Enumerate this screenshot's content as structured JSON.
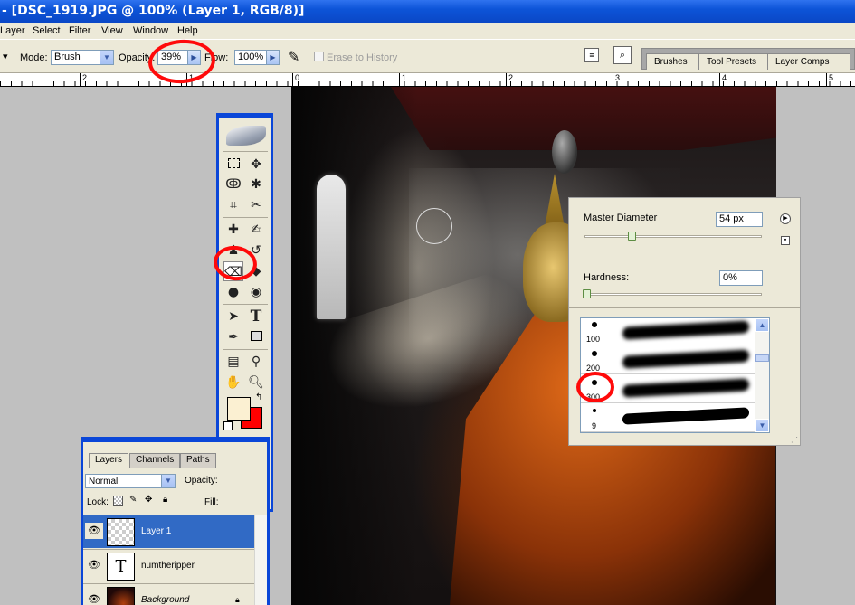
{
  "window": {
    "title": "- [DSC_1919.JPG @ 100% (Layer 1, RGB/8)]"
  },
  "menu": [
    "Layer",
    "Select",
    "Filter",
    "View",
    "Window",
    "Help"
  ],
  "options": {
    "tool_preset_arrow": "▾",
    "mode_label": "Mode:",
    "mode_value": "Brush",
    "opacity_label": "Opacity:",
    "opacity_value": "39%",
    "flow_label": "Flow:",
    "flow_value": "100%",
    "erase_to_history": "Erase to History",
    "well_tabs": [
      "Brushes",
      "Tool Presets",
      "Layer Comps"
    ]
  },
  "ruler": {
    "labels": [
      "2",
      "1",
      "0",
      "1",
      "2",
      "3",
      "4",
      "5"
    ]
  },
  "toolbox": {
    "tools": [
      "rect-marquee",
      "move",
      "lasso",
      "magic-wand",
      "crop",
      "slice",
      "healing-brush",
      "brush",
      "clone-stamp",
      "history-brush",
      "eraser",
      "paint-bucket",
      "dodge",
      "burn",
      "path-select",
      "type",
      "pen",
      "shape",
      "notes",
      "eyedropper",
      "hand",
      "zoom"
    ],
    "type_glyph": "T",
    "foreground_color": "#fbf0d2",
    "background_color": "#ff0000"
  },
  "brush_panel": {
    "master_diameter_label": "Master Diameter",
    "master_diameter_value": "54 px",
    "master_diameter_fraction": 0.27,
    "hardness_label": "Hardness:",
    "hardness_value": "0%",
    "hardness_fraction": 0.0,
    "brushes": [
      {
        "size": "100"
      },
      {
        "size": "200"
      },
      {
        "size": "300"
      },
      {
        "size": "9"
      }
    ]
  },
  "layers_panel": {
    "tabs": [
      "Layers",
      "Channels",
      "Paths"
    ],
    "blend_mode": "Normal",
    "opacity_label": "Opacity:",
    "lock_label": "Lock:",
    "fill_label": "Fill:",
    "layers": [
      {
        "name": "Layer 1",
        "selected": true
      },
      {
        "name": "numtheripper",
        "thumb_glyph": "T"
      },
      {
        "name": "Background",
        "locked": true
      }
    ]
  },
  "annotations": {
    "color": "#ff0a0a"
  }
}
